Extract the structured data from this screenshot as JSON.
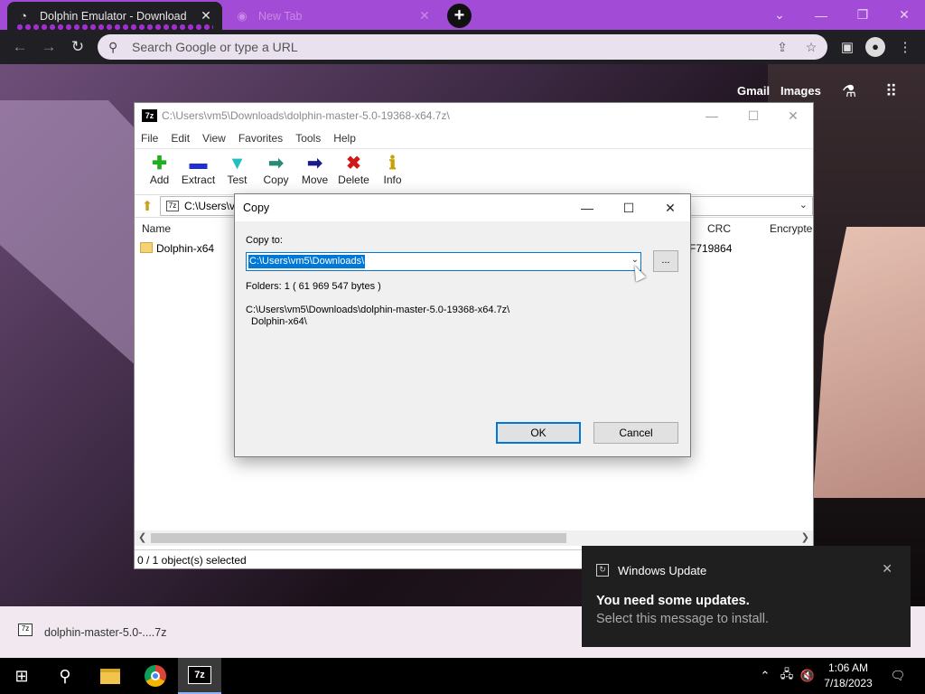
{
  "browser": {
    "tabs": [
      {
        "title": "Dolphin Emulator - Download",
        "icon": "dolphin-icon"
      },
      {
        "title": "New Tab",
        "icon": "chrome-icon"
      }
    ],
    "new_tab_label": "+",
    "address_placeholder": "Search Google or type a URL",
    "page_links": {
      "gmail": "Gmail",
      "images": "Images"
    }
  },
  "sevenzip": {
    "title": "C:\\Users\\vm5\\Downloads\\dolphin-master-5.0-19368-x64.7z\\",
    "logo": "7z",
    "menu": [
      "File",
      "Edit",
      "View",
      "Favorites",
      "Tools",
      "Help"
    ],
    "toolbar": [
      {
        "label": "Add",
        "icon": "add-icon",
        "glyph": "✚",
        "color": "#1fae1f"
      },
      {
        "label": "Extract",
        "icon": "extract-icon",
        "glyph": "▬",
        "color": "#1f2fd0"
      },
      {
        "label": "Test",
        "icon": "test-icon",
        "glyph": "▼",
        "color": "#20c0c0"
      },
      {
        "label": "Copy",
        "icon": "copy-icon",
        "glyph": "➡",
        "color": "#2a8a7a"
      },
      {
        "label": "Move",
        "icon": "move-icon",
        "glyph": "➡",
        "color": "#1a1a8a"
      },
      {
        "label": "Delete",
        "icon": "delete-icon",
        "glyph": "✖",
        "color": "#d01818"
      },
      {
        "label": "Info",
        "icon": "info-icon",
        "glyph": "ℹ",
        "color": "#c8a000"
      }
    ],
    "address": "C:\\Users\\v",
    "columns": {
      "name": "Name",
      "crc": "CRC",
      "encrypted": "Encrypte"
    },
    "rows": [
      {
        "name": "Dolphin-x64",
        "crc": "F719864"
      }
    ],
    "status": "0 / 1 object(s) selected"
  },
  "copy_dialog": {
    "title": "Copy",
    "copy_to_label": "Copy to:",
    "destination": "C:\\Users\\vm5\\Downloads\\",
    "browse_label": "...",
    "folders_info": "Folders: 1    ( 61 969 547 bytes )",
    "source_path_line1": "C:\\Users\\vm5\\Downloads\\dolphin-master-5.0-19368-x64.7z\\",
    "source_path_line2": "Dolphin-x64\\",
    "ok_label": "OK",
    "cancel_label": "Cancel"
  },
  "download_bar": {
    "file": "dolphin-master-5.0-....7z"
  },
  "notification": {
    "app": "Windows Update",
    "headline": "You need some updates.",
    "body": "Select this message to install."
  },
  "taskbar": {
    "time": "1:06 AM",
    "date": "7/18/2023",
    "seven_zip_label": "7z"
  }
}
